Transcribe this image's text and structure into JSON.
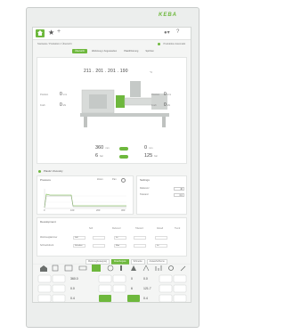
{
  "brand": "KEBA",
  "topbar": {
    "breadcrumb": "Startseite / Produktion / Übersicht",
    "status": "Produktion Automatik"
  },
  "tabs": [
    {
      "label": "Übersicht",
      "active": true
    },
    {
      "label": "Werkzeug / Angussarten",
      "active": false
    },
    {
      "label": "Plastifizierung",
      "active": false
    },
    {
      "label": "Spritzen",
      "active": false
    }
  ],
  "machine": {
    "temps": "211 . 201 . 201 . 190",
    "temp_unit": "°C",
    "left_rows": [
      {
        "label": "Position",
        "value": "0",
        "unit": "mm"
      },
      {
        "label": "Kraft",
        "value": "0",
        "unit": "kN"
      }
    ],
    "right_rows": [
      {
        "label": "Position",
        "value": "0",
        "unit": "mm"
      },
      {
        "label": "Kraft",
        "value": "0",
        "unit": "kN"
      }
    ],
    "inj_value": "360",
    "inj_unit": "mm",
    "mold_value": "6",
    "mold_unit": "bar",
    "inj_value2": "0",
    "inj_unit2": "mm",
    "mold_value2": "125",
    "mold_unit2": "bar"
  },
  "viscosity": {
    "title": "Plastic Viscosity",
    "pressure_title": "Pressure",
    "zoom": "Zoom",
    "pan": "Pan",
    "settings_title": "Settings",
    "settings": [
      {
        "label": "Referenz",
        "value": "40"
      },
      {
        "label": "Toleranz",
        "value": "0.0"
      }
    ],
    "chart_x_ticks": [
      "0",
      "100",
      "200",
      "300"
    ]
  },
  "development": {
    "title": "Development",
    "columns": [
      "Soll",
      "Referenz",
      "Toleranz",
      "Aktuell",
      "Trend"
    ],
    "rows": [
      {
        "label": "Werkzeugkammer",
        "cells": [
          "Soll",
          "",
          "Ist",
          "",
          ""
        ]
      },
      {
        "label": "Schmelzdruck",
        "cells": [
          "Schalten",
          "",
          "Max",
          "",
          "Ist"
        ]
      }
    ]
  },
  "bottom_tabs": [
    {
      "label": "Werkzeugbewegung",
      "active": false
    },
    {
      "label": "Düse/Anguss",
      "active": true
    },
    {
      "label": "Schnecke",
      "active": false
    },
    {
      "label": "Auswerfer/Kerne",
      "active": false
    },
    {
      "label": "Schließeinheit",
      "active": false
    }
  ],
  "icon_row": [
    "home-icon",
    "grid-icon",
    "mold-icon",
    "nozzle-icon",
    "screen-icon",
    "robot-icon",
    "thermo-icon",
    "ejector-icon",
    "heat-icon",
    "chart-icon",
    "gear-icon",
    "tool-icon"
  ],
  "keypad": {
    "left_values": [
      "360.0",
      "0.0",
      "0.4"
    ],
    "mid_values": [
      "0",
      "6",
      "0"
    ],
    "right_values": [
      "0.0",
      "121.7",
      "0.4"
    ]
  },
  "colors": {
    "accent": "#6eb83d"
  }
}
